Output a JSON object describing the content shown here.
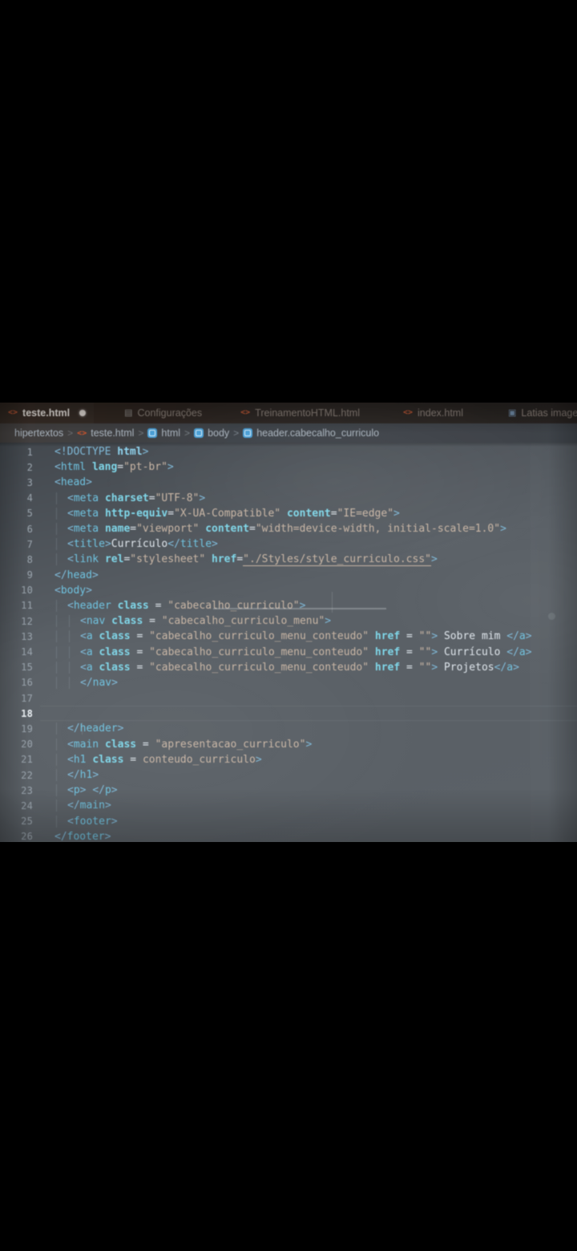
{
  "window": {
    "app": "Visual Studio Code",
    "accent_active_tab": "#e9e3dd",
    "accent_html_icon": "#d2552b",
    "accent_tag_icon": "#4a9fd6",
    "editor_bg": "#5b6167",
    "tabbar_bg": "#2c2724",
    "breadcrumb_bg": "#3e4349"
  },
  "tabs": [
    {
      "label": "teste.html",
      "icon": "html-file-icon",
      "active": true,
      "dirty": true
    },
    {
      "label": "Configurações",
      "icon": "settings-gear-icon",
      "active": false,
      "dirty": false
    },
    {
      "label": "TreinamentoHTML.html",
      "icon": "html-file-icon",
      "active": false,
      "dirty": false
    },
    {
      "label": "index.html",
      "icon": "html-file-icon",
      "active": false,
      "dirty": false
    },
    {
      "label": "Latias image.PNG",
      "icon": "image-file-icon",
      "active": false,
      "dirty": false
    }
  ],
  "breadcrumb": [
    {
      "label": "hipertextos",
      "icon": ""
    },
    {
      "label": "teste.html",
      "icon": "html-file-icon"
    },
    {
      "label": "html",
      "icon": "html-tag-icon"
    },
    {
      "label": "body",
      "icon": "html-tag-icon"
    },
    {
      "label": "header.cabecalho_curriculo",
      "icon": "html-tag-icon"
    }
  ],
  "breadcrumb_separator": ">",
  "editor": {
    "language": "HTML",
    "current_line": 18,
    "lines": [
      {
        "n": "1",
        "indent": 0,
        "text": "<!DOCTYPE html>"
      },
      {
        "n": "2",
        "indent": 0,
        "text": "<html lang=\"pt-br\">"
      },
      {
        "n": "3",
        "indent": 0,
        "text": "<head>"
      },
      {
        "n": "4",
        "indent": 1,
        "text": "<meta charset=\"UTF-8\">"
      },
      {
        "n": "5",
        "indent": 1,
        "text": "<meta http-equiv=\"X-UA-Compatible\" content=\"IE=edge\">"
      },
      {
        "n": "6",
        "indent": 1,
        "text": "<meta name=\"viewport\" content=\"width=device-width, initial-scale=1.0\">"
      },
      {
        "n": "7",
        "indent": 1,
        "text": "<title>Currículo</title>"
      },
      {
        "n": "8",
        "indent": 1,
        "text": "<link rel=\"stylesheet\" href=\"./Styles/style_curriculo.css\">"
      },
      {
        "n": "9",
        "indent": 0,
        "text": "</head>"
      },
      {
        "n": "10",
        "indent": 0,
        "text": "<body>"
      },
      {
        "n": "11",
        "indent": 1,
        "text": "<header class = \"cabecalho_curriculo\">"
      },
      {
        "n": "12",
        "indent": 2,
        "text": "<nav class = \"cabecalho_curriculo_menu\">"
      },
      {
        "n": "13",
        "indent": 2,
        "text": "<a class = \"cabecalho_curriculo_menu_conteudo\" href = \"\"> Sobre mim </a>"
      },
      {
        "n": "14",
        "indent": 2,
        "text": "<a class = \"cabecalho_curriculo_menu_conteudo\" href = \"\"> Currículo </a>"
      },
      {
        "n": "15",
        "indent": 2,
        "text": "<a class = \"cabecalho_curriculo_menu_conteudo\" href = \"\"> Projetos</a>"
      },
      {
        "n": "16",
        "indent": 2,
        "text": "</nav>"
      },
      {
        "n": "17",
        "indent": 0,
        "text": ""
      },
      {
        "n": "18",
        "indent": 0,
        "text": ""
      },
      {
        "n": "19",
        "indent": 1,
        "text": "</header>"
      },
      {
        "n": "20",
        "indent": 1,
        "text": "<main class = \"apresentacao_curriculo\">"
      },
      {
        "n": "21",
        "indent": 1,
        "text": "<h1 class = conteudo_curriculo>"
      },
      {
        "n": "22",
        "indent": 1,
        "text": "</h1>"
      },
      {
        "n": "23",
        "indent": 1,
        "text": "<p> </p>"
      },
      {
        "n": "24",
        "indent": 1,
        "text": "</main>"
      },
      {
        "n": "25",
        "indent": 1,
        "text": "<footer>"
      },
      {
        "n": "26",
        "indent": 0,
        "text": "</footer>"
      }
    ]
  }
}
